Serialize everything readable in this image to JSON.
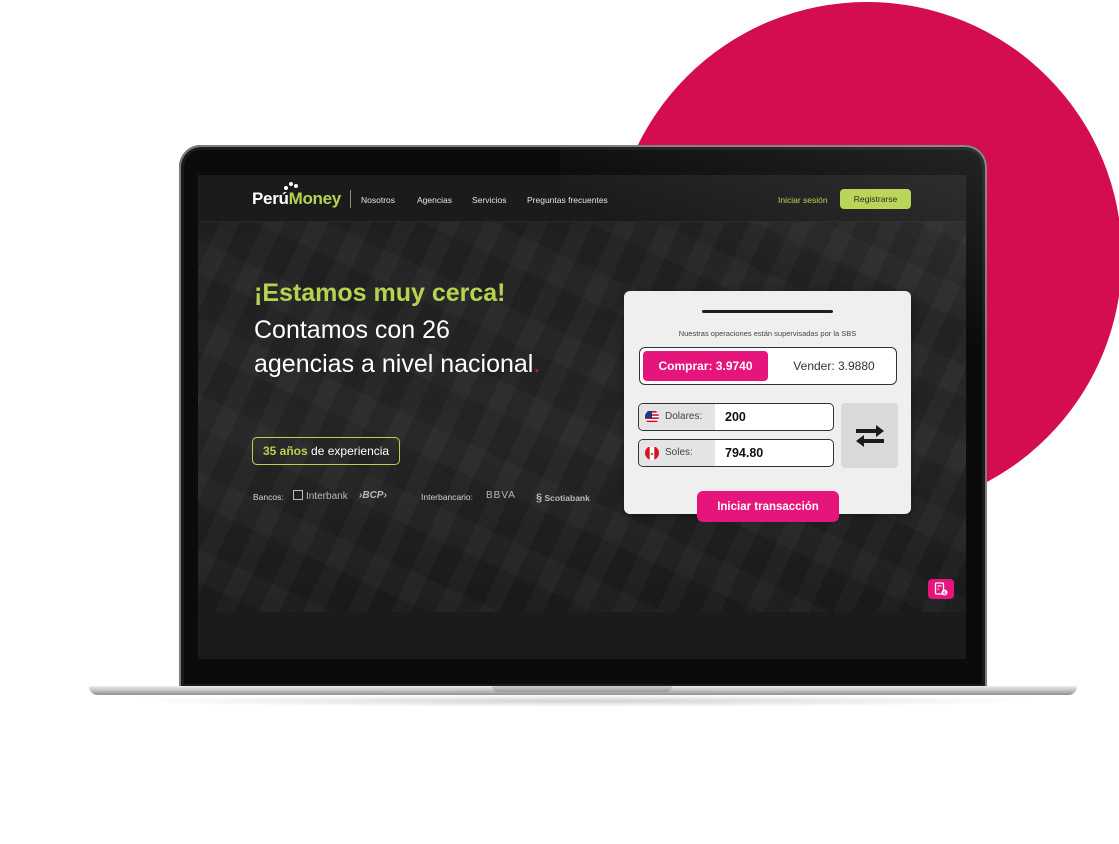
{
  "brand": {
    "name_part1": "Perú",
    "name_part2": "Money",
    "accent": "#b6d34f",
    "pink": "#e5157b",
    "circle": "#d40d4e"
  },
  "nav": {
    "links": [
      "Nosotros",
      "Agencias",
      "Servicios",
      "Preguntas frecuentes"
    ],
    "login": "Iniciar sesión",
    "register": "Registrarse"
  },
  "hero": {
    "headline": "¡Estamos muy cerca!",
    "subline": "Contamos con 26 agencias a nivel nacional",
    "period": ".",
    "badge_bold": "35 años",
    "badge_rest": " de experiencia"
  },
  "banks": {
    "label": "Bancos:",
    "list": [
      "Interbank",
      "BCP"
    ],
    "interbank_label": "Interbancario:",
    "interbank_list": [
      "BBVA",
      "Scotiabank"
    ]
  },
  "exchange": {
    "note": "Nuestras operaciones están supervisadas por la SBS",
    "buy": "Comprar: 3.9740",
    "sell": "Vender: 3.9880",
    "from": {
      "label": "Dolares:",
      "value": "200",
      "flag": "us-flag-icon"
    },
    "to": {
      "label": "Soles:",
      "value": "794.80",
      "flag": "peru-flag-icon"
    },
    "swap_icon": "swap-arrows-icon",
    "cta": "Iniciar transacción"
  },
  "floating": {
    "icon": "calculator-icon"
  }
}
